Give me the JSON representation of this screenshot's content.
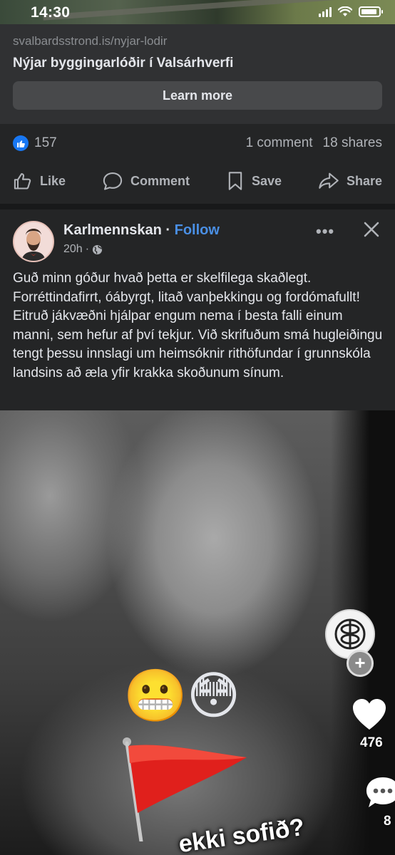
{
  "status_bar": {
    "time": "14:30",
    "battery_level": 0.9
  },
  "link_card": {
    "domain": "svalbardsstrond.is/nyjar-lodir",
    "title": "Nýjar byggingarlóðir í Valsárhverfi",
    "cta": "Learn more"
  },
  "reactions": {
    "likes": "157",
    "comments": "1 comment",
    "shares": "18 shares"
  },
  "actions": {
    "like": "Like",
    "comment": "Comment",
    "save": "Save",
    "share": "Share"
  },
  "post": {
    "author": "Karlmennskan",
    "separator": " · ",
    "follow": "Follow",
    "time": "20h",
    "privacy_icon": "globe-icon",
    "text": "Guð minn góður hvað þetta er skelfilega skaðlegt. Forréttindafirrt, óábyrgt, litað vanþekkingu og fordómafullt! Eitruð jákvæðni hjálpar engum nema í besta falli einum manni, sem hefur af því tekjur. Við skrifuðum smá hugleiðingu tengt þessu innslagi um heimsóknir rithöfundar í grunnskóla landsins að æla yfir krakka skoðunum sínum."
  },
  "video": {
    "emoji_1": "😬",
    "emoji_2": "😳",
    "caption": "ekki sofið?",
    "add_symbol": "+",
    "likes": "476",
    "comments": "8"
  },
  "colors": {
    "accent": "#4a8fe4",
    "like_blue": "#1877f2",
    "flag_red": "#e0201c",
    "background": "#242526"
  }
}
